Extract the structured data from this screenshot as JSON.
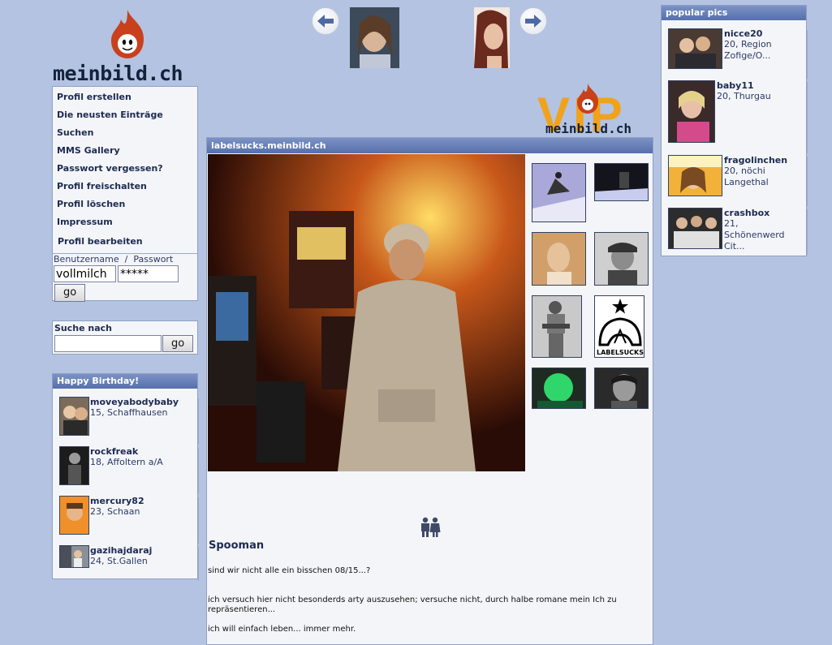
{
  "site": {
    "logo_text": "meinbild.ch",
    "vip_text": "VIP",
    "vip_sub": "meinbild.ch"
  },
  "colors": {
    "background": "#b3c3e1",
    "box_header": "#5670ab",
    "flame": "#c9401d",
    "vip": "#f1a21b"
  },
  "menu": {
    "items": [
      "Profil erstellen",
      "Die neusten Einträge",
      "Suchen",
      "MMS Gallery",
      "Passwort vergessen?",
      "Profil freischalten",
      "Profil löschen",
      "Impressum"
    ],
    "edit_profile": "Profil bearbeiten"
  },
  "login": {
    "user_label": "Benutzername",
    "separator": "/",
    "pass_label": "Passwort",
    "username": "vollmilch",
    "password": "*****",
    "go": "go"
  },
  "search": {
    "label": "Suche nach",
    "value": "",
    "go": "go"
  },
  "birthday": {
    "title": "Happy Birthday!",
    "people": [
      {
        "name": "moveyabodybaby",
        "info": "15, Schaffhausen"
      },
      {
        "name": "rockfreak",
        "info": "18, Affoltern a/A"
      },
      {
        "name": "mercury82",
        "info": "23, Schaan"
      },
      {
        "name": "gazihajdaraj",
        "info": "24, St.Gallen"
      }
    ]
  },
  "popular": {
    "title": "popular pics",
    "people": [
      {
        "name": "nicce20",
        "info": "20, Region Zofige/O..."
      },
      {
        "name": "baby11",
        "info": "20, Thurgau"
      },
      {
        "name": "fragolinchen",
        "info": "20, nöchi Langethal"
      },
      {
        "name": "crashbox",
        "info": "21, Schönenwerd Cit..."
      }
    ]
  },
  "top_nav": {
    "prev_icon": "arrow-left-icon",
    "next_icon": "arrow-right-icon"
  },
  "profile": {
    "header": "labelsucks.meinbild.ch",
    "username": "Spooman",
    "gallery_brand": "LABELSUCKS",
    "gender_icon": "couple-icon",
    "text_1": "sind wir nicht alle ein bisschen 08/15...?",
    "text_2": "ich versuch hier nicht besonderds arty auszusehen; versuche nicht, durch halbe romane mein Ich zu repräsentieren...",
    "text_3": "ich will einfach leben... immer mehr."
  }
}
